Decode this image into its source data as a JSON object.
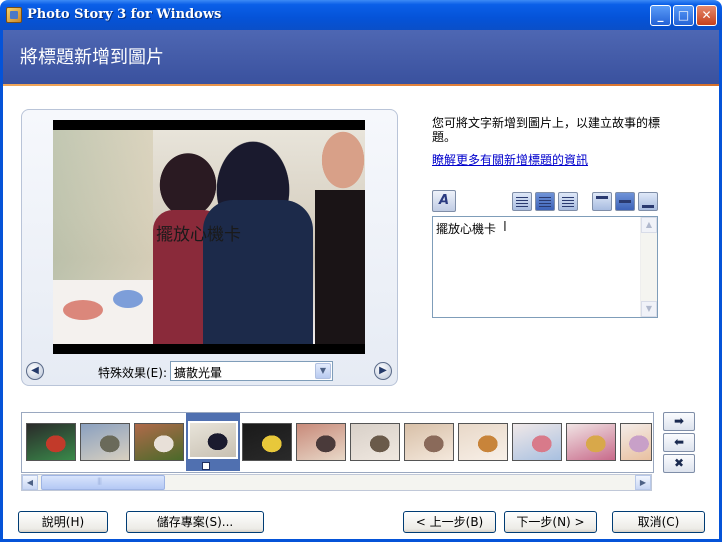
{
  "window": {
    "title": "Photo Story 3 for Windows",
    "min_label": "_",
    "max_label": "□",
    "close_label": "✕"
  },
  "header": {
    "title": "將標題新增到圖片"
  },
  "preview": {
    "caption": "擺放心機卡",
    "effect_label": "特殊效果(E):",
    "effect_value": "擴散光暈",
    "prev_icon": "◀",
    "next_icon": "▶"
  },
  "right_panel": {
    "instructions": "您可將文字新增到圖片上，以建立故事的標題。",
    "help_link": "瞭解更多有關新增標題的資訊",
    "text_value": "擺放心機卡",
    "font_icon": "A"
  },
  "filmstrip": {
    "thumbnails": [
      {
        "colors": [
          "#2a2a2a",
          "#c23a2a",
          "#3a8a4a"
        ]
      },
      {
        "colors": [
          "#8aa0c0",
          "#6a6a5a",
          "#d8d0c0"
        ]
      },
      {
        "colors": [
          "#b06a4a",
          "#e8e0d8",
          "#4a6a2a"
        ]
      },
      {
        "colors": [
          "#e8e4da",
          "#1a1a2e",
          "#c8c0b2"
        ]
      },
      {
        "colors": [
          "#1a1a1a",
          "#e8c83a",
          "#2a2a2a"
        ]
      },
      {
        "colors": [
          "#c88a7a",
          "#4a3a3a",
          "#e8d8c8"
        ]
      },
      {
        "colors": [
          "#d8d0c8",
          "#6a5a4a",
          "#f0e8e0"
        ]
      },
      {
        "colors": [
          "#d8c0a8",
          "#8a6a5a",
          "#f4e8dc"
        ]
      },
      {
        "colors": [
          "#e8d8c8",
          "#c8843a",
          "#f8f0e8"
        ]
      },
      {
        "colors": [
          "#f0e8e8",
          "#d87a8a",
          "#a8c0e0"
        ]
      },
      {
        "colors": [
          "#f0e4e4",
          "#d8a84a",
          "#c86a8a"
        ]
      },
      {
        "colors": [
          "#f4ece8",
          "#c8a0c8",
          "#e8c0a0"
        ]
      }
    ],
    "selected_index": 3,
    "move_right_icon": "➡",
    "move_left_icon": "⬅",
    "remove_icon": "✖"
  },
  "buttons": {
    "help": "說明(H)",
    "save_project": "儲存專案(S)...",
    "back": "< 上一步(B)",
    "next": "下一步(N) >",
    "cancel": "取消(C)"
  },
  "colors": {
    "titlebar": "#0553d8",
    "header_band": "#4560aa",
    "accent_line": "#e0803a"
  }
}
